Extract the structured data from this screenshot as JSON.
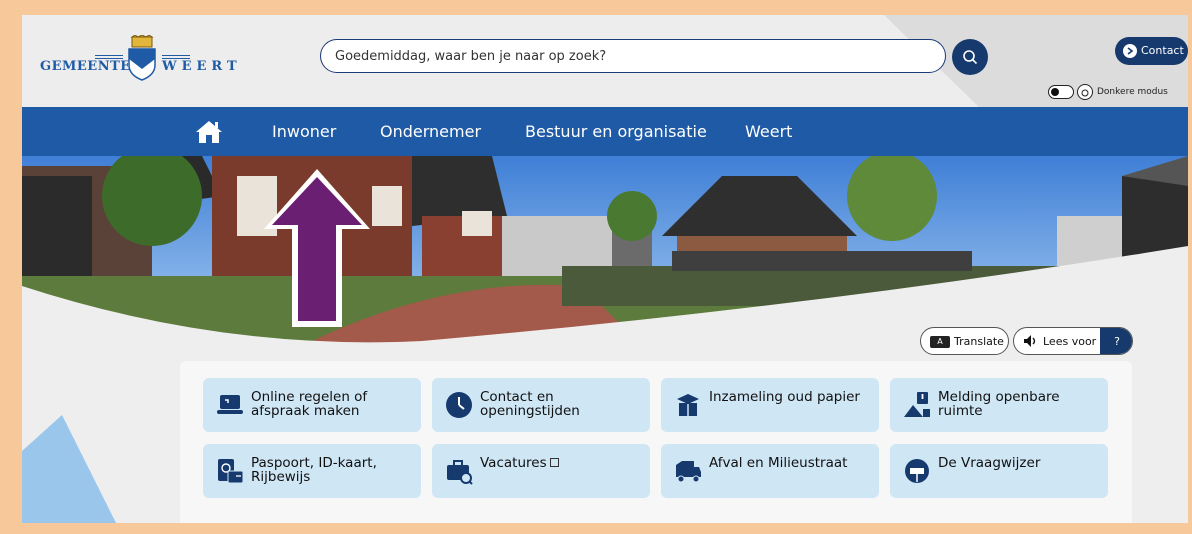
{
  "header": {
    "logo_left": "GEMEENTE",
    "logo_right": "WEERT",
    "search_placeholder": "Goedemiddag, waar ben je naar op zoek?",
    "contact_label": "Contact",
    "dark_mode_label": "Donkere modus"
  },
  "nav": {
    "items": [
      "Inwoner",
      "Ondernemer",
      "Bestuur en organisatie",
      "Weert"
    ]
  },
  "tools": {
    "translate_label": "Translate",
    "translate_icon_text": "A",
    "read_aloud_label": "Lees voor",
    "help_label": "?"
  },
  "annotation": {
    "color": "#6b1f73",
    "points_to": "Inwoner"
  },
  "quick_links": [
    {
      "label": "Online regelen of afspraak maken",
      "icon": "laptop-icon"
    },
    {
      "label": "Contact en openingstijden",
      "icon": "clock-icon"
    },
    {
      "label": "Inzameling oud papier",
      "icon": "boxes-icon"
    },
    {
      "label": "Melding openbare ruimte",
      "icon": "report-icon"
    },
    {
      "label": "Paspoort, ID-kaart, Rijbewijs",
      "icon": "passport-icon"
    },
    {
      "label": "Vacatures",
      "icon": "briefcase-icon",
      "external": true
    },
    {
      "label": "Afval en Milieustraat",
      "icon": "truck-icon"
    },
    {
      "label": "De Vraagwijzer",
      "icon": "vraagwijzer-icon"
    }
  ],
  "colors": {
    "brand_blue": "#1f5aa6",
    "dark_navy": "#163a6e",
    "tile_bg": "#cfe6f5",
    "frame_border": "#f7c99a"
  }
}
